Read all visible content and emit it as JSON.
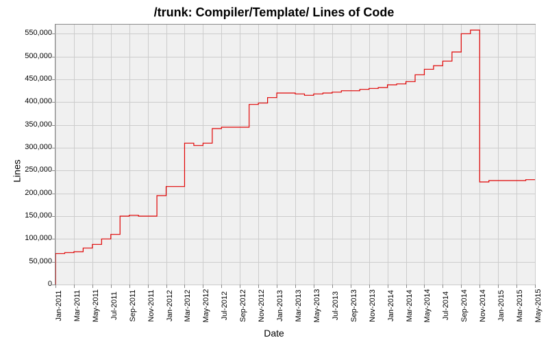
{
  "chart_data": {
    "type": "line",
    "title": "/trunk: Compiler/Template/ Lines of Code",
    "xlabel": "Date",
    "ylabel": "Lines",
    "ylim": [
      0,
      570000
    ],
    "y_ticks": [
      0,
      50000,
      100000,
      150000,
      200000,
      250000,
      300000,
      350000,
      400000,
      450000,
      500000,
      550000
    ],
    "y_tick_labels": [
      "0",
      "50,000",
      "100,000",
      "150,000",
      "200,000",
      "250,000",
      "300,000",
      "350,000",
      "400,000",
      "450,000",
      "500,000",
      "550,000"
    ],
    "x_ticks": [
      "Jan-2011",
      "Mar-2011",
      "May-2011",
      "Jul-2011",
      "Sep-2011",
      "Nov-2011",
      "Jan-2012",
      "Mar-2012",
      "May-2012",
      "Jul-2012",
      "Sep-2012",
      "Nov-2012",
      "Jan-2013",
      "Mar-2013",
      "May-2013",
      "Jul-2013",
      "Sep-2013",
      "Nov-2013",
      "Jan-2014",
      "Mar-2014",
      "May-2014",
      "Jul-2014",
      "Sep-2014",
      "Nov-2014",
      "Jan-2015",
      "Mar-2015",
      "May-2015"
    ],
    "series": [
      {
        "name": "Lines of Code",
        "color": "#e00000",
        "x": [
          "Jan-2011",
          "Feb-2011",
          "Mar-2011",
          "Apr-2011",
          "May-2011",
          "Jun-2011",
          "Jul-2011",
          "Aug-2011",
          "Sep-2011",
          "Oct-2011",
          "Nov-2011",
          "Dec-2011",
          "Jan-2012",
          "Feb-2012",
          "Mar-2012",
          "Apr-2012",
          "May-2012",
          "Jun-2012",
          "Jul-2012",
          "Aug-2012",
          "Sep-2012",
          "Oct-2012",
          "Nov-2012",
          "Dec-2012",
          "Jan-2013",
          "Feb-2013",
          "Mar-2013",
          "Apr-2013",
          "May-2013",
          "Jun-2013",
          "Jul-2013",
          "Aug-2013",
          "Sep-2013",
          "Oct-2013",
          "Nov-2013",
          "Dec-2013",
          "Jan-2014",
          "Feb-2014",
          "Mar-2014",
          "Apr-2014",
          "May-2014",
          "Jun-2014",
          "Jul-2014",
          "Aug-2014",
          "Sep-2014",
          "Oct-2014",
          "Nov-2014",
          "Dec-2014",
          "Jan-2015",
          "Feb-2015",
          "Mar-2015",
          "Apr-2015",
          "May-2015"
        ],
        "values": [
          68000,
          70000,
          72000,
          80000,
          88000,
          100000,
          110000,
          150000,
          152000,
          150000,
          150000,
          195000,
          215000,
          215000,
          310000,
          305000,
          310000,
          342000,
          345000,
          345000,
          345000,
          395000,
          398000,
          410000,
          420000,
          420000,
          418000,
          415000,
          418000,
          420000,
          422000,
          425000,
          425000,
          428000,
          430000,
          432000,
          438000,
          440000,
          445000,
          460000,
          472000,
          480000,
          490000,
          510000,
          550000,
          558000,
          225000,
          228000,
          228000,
          228000,
          228000,
          230000,
          230000
        ]
      }
    ]
  }
}
